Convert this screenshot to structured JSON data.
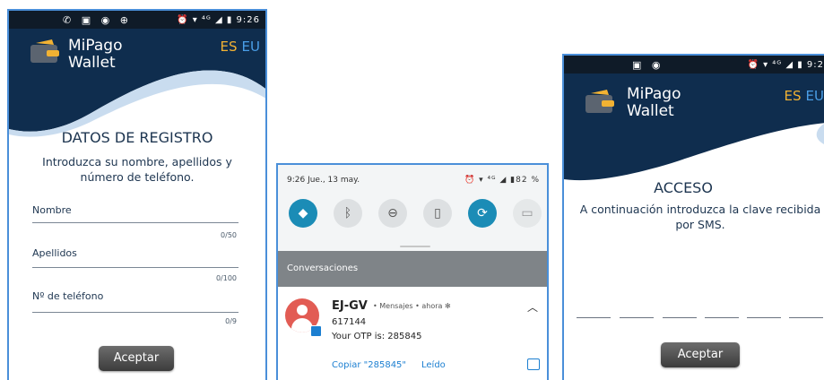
{
  "registration": {
    "status": {
      "left_icons": "✆ ▣ ◉ ⊕",
      "right": "⏰ ▾ ⁴ᴳ ◢ ▮ 9:26"
    },
    "brand": {
      "line1": "MiPago",
      "line2": "Wallet",
      "icon": "wallet-icon"
    },
    "lang": {
      "es": "ES",
      "eu": "EU"
    },
    "title": "DATOS DE REGISTRO",
    "subtitle": "Introduzca su nombre, apellidos y número de teléfono.",
    "fields": [
      {
        "label": "Nombre",
        "counter": "0/50"
      },
      {
        "label": "Apellidos",
        "counter": "0/100"
      },
      {
        "label": "Nº de teléfono",
        "counter": "0/9"
      }
    ],
    "button": "Aceptar"
  },
  "notification_shade": {
    "datetime": "9:26 Jue., 13 may.",
    "status_right": "⏰ ▾ ⁴ᴳ ◢ ▮82 %",
    "quick_settings": [
      {
        "icon": "wifi-icon",
        "glyph": "◆",
        "active": true
      },
      {
        "icon": "bluetooth-icon",
        "glyph": "ᛒ",
        "active": false
      },
      {
        "icon": "do-not-disturb-icon",
        "glyph": "⊖",
        "active": false
      },
      {
        "icon": "flashlight-icon",
        "glyph": "▯",
        "active": false
      },
      {
        "icon": "auto-rotate-icon",
        "glyph": "⟳",
        "active": true
      },
      {
        "icon": "battery-saver-icon",
        "glyph": "▭",
        "active": false
      }
    ],
    "section": "Conversaciones",
    "notification": {
      "sender": "EJ-GV",
      "meta": "• Mensajes • ahora ✻",
      "line1": "617144",
      "line2": "Your OTP is: 285845",
      "action_copy": "Copiar \"285845\"",
      "action_read": "Leído"
    }
  },
  "access": {
    "status": {
      "left_icons": "▣ ◉",
      "right": "⏰ ▾ ⁴ᴳ ◢ ▮ 9:2"
    },
    "brand": {
      "line1": "MiPago",
      "line2": "Wallet",
      "icon": "wallet-icon"
    },
    "lang": {
      "es": "ES",
      "eu": "EU"
    },
    "title": "ACCESO",
    "subtitle": "A continuación introduzca la clave recibida por SMS.",
    "otp_slots": 6,
    "button": "Aceptar"
  },
  "colors": {
    "navy": "#0f2d4e",
    "accent": "#f2b233",
    "lang_eu": "#4a9fe8",
    "frame": "#4a8fd9",
    "qs_active": "#1b8cb6"
  }
}
